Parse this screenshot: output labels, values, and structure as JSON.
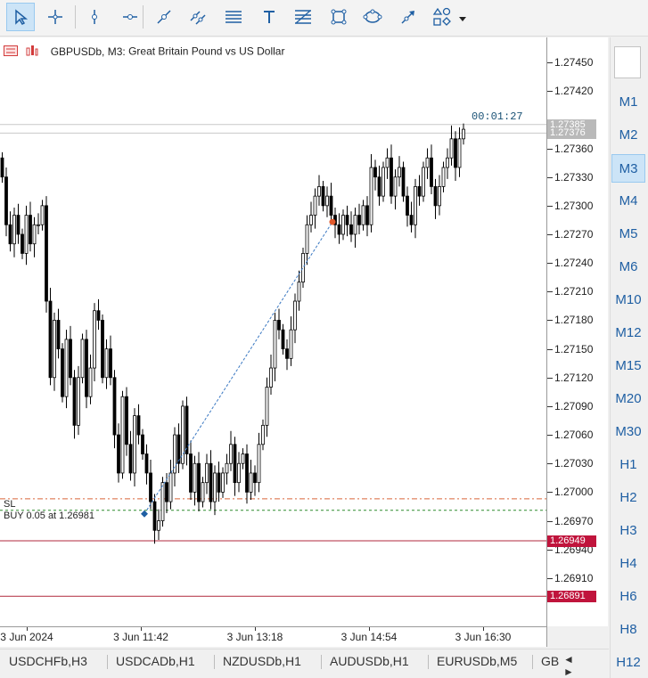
{
  "toolbar": {
    "tools": [
      {
        "icon": "cursor-arrow-icon",
        "selected": true
      },
      {
        "icon": "crosshair-icon",
        "selected": false
      },
      {
        "icon": "vertical-line-icon",
        "selected": false
      },
      {
        "icon": "horizontal-line-icon",
        "selected": false
      },
      {
        "icon": "trend-line-icon",
        "selected": false
      },
      {
        "icon": "parallel-channel-icon",
        "selected": false
      },
      {
        "icon": "fibonacci-retracement-icon",
        "selected": false
      },
      {
        "icon": "text-icon",
        "selected": false
      },
      {
        "icon": "fibonacci-fan-icon",
        "selected": false
      },
      {
        "icon": "rectangle-icon",
        "selected": false
      },
      {
        "icon": "ellipse-icon",
        "selected": false
      },
      {
        "icon": "arrow-line-icon",
        "selected": false
      },
      {
        "icon": "shapes-icon",
        "selected": false
      }
    ],
    "dropdown_icon": "dropdown-triangle-icon"
  },
  "chart": {
    "symbol": "GBPUSDb, M3:",
    "description": "Great Britain Pound vs US Dollar",
    "timer": "00:01:27",
    "sl_label": "SL",
    "buy_label": "BUY 0.05 at 1.26981"
  },
  "price_scale": {
    "labels": [
      "1.27450",
      "1.27420",
      "1.27360",
      "1.27330",
      "1.27300",
      "1.27270",
      "1.27240",
      "1.27210",
      "1.27180",
      "1.27150",
      "1.27120",
      "1.27090",
      "1.27060",
      "1.27030",
      "1.27000",
      "1.26970",
      "1.26940",
      "1.26910"
    ],
    "ask_badge": "1.27385",
    "bid_badge": "1.27376",
    "sl_badge": "1.26949",
    "low_badge": "1.26891",
    "colors": {
      "badge_gray": "#b9b9b9",
      "badge_red": "#c0143c"
    }
  },
  "time_scale": {
    "labels": [
      "3 Jun 2024",
      "3 Jun 11:42",
      "3 Jun 13:18",
      "3 Jun 14:54",
      "3 Jun 16:30"
    ]
  },
  "tabs": {
    "items": [
      "USDCHFb,H3",
      "USDCADb,H1",
      "NZDUSDb,H1",
      "AUDUSDb,H1",
      "EURUSDb,M5",
      "GB"
    ],
    "left_arrow": "◄",
    "right_arrow": "►"
  },
  "timeframes": {
    "items": [
      "M1",
      "M2",
      "M3",
      "M4",
      "M5",
      "M6",
      "M10",
      "M12",
      "M15",
      "M20",
      "M30",
      "H1",
      "H2",
      "H3",
      "H4",
      "H6",
      "H8",
      "H12"
    ],
    "selected": "M3"
  },
  "chart_data": {
    "type": "candlestick",
    "symbol": "GBPUSDb",
    "timeframe": "M3",
    "ylim": [
      1.2688,
      1.27465
    ],
    "ask": 1.27385,
    "bid": 1.27376,
    "stop_loss": 1.26949,
    "buy_entry": 1.26981,
    "buy_volume": 0.05,
    "close": [
      1.2733,
      1.2728,
      1.2726,
      1.2729,
      1.2727,
      1.2725,
      1.2729,
      1.2726,
      1.2728,
      1.2728,
      1.273,
      1.272,
      1.2712,
      1.2718,
      1.2715,
      1.271,
      1.2716,
      1.2712,
      1.2707,
      1.2712,
      1.2716,
      1.271,
      1.2713,
      1.2719,
      1.2718,
      1.2712,
      1.2715,
      1.2712,
      1.2706,
      1.2702,
      1.271,
      1.2705,
      1.2702,
      1.2708,
      1.2706,
      1.2704,
      1.2702,
      1.2699,
      1.2696,
      1.2697,
      1.2701,
      1.2699,
      1.2702,
      1.2706,
      1.2703,
      1.2709,
      1.2704,
      1.27,
      1.2703,
      1.2699,
      1.2701,
      1.2703,
      1.2699,
      1.2702,
      1.27,
      1.2702,
      1.2703,
      1.2705,
      1.2701,
      1.2703,
      1.2704,
      1.27,
      1.2702,
      1.2701,
      1.2705,
      1.2707,
      1.2711,
      1.2713,
      1.2718,
      1.2717,
      1.2715,
      1.2714,
      1.2717,
      1.272,
      1.2722,
      1.2725,
      1.2728,
      1.2729,
      1.2731,
      1.2732,
      1.273,
      1.2731,
      1.2729,
      1.2728,
      1.2727,
      1.2729,
      1.2728,
      1.2727,
      1.2729,
      1.2728,
      1.273,
      1.2728,
      1.2734,
      1.2733,
      1.2731,
      1.2734,
      1.2735,
      1.2731,
      1.2733,
      1.2734,
      1.2731,
      1.2729,
      1.2728,
      1.2732,
      1.2731,
      1.2734,
      1.2735,
      1.2732,
      1.273,
      1.2732,
      1.2734,
      1.2735,
      1.2737,
      1.2734,
      1.2737,
      1.2738
    ]
  }
}
